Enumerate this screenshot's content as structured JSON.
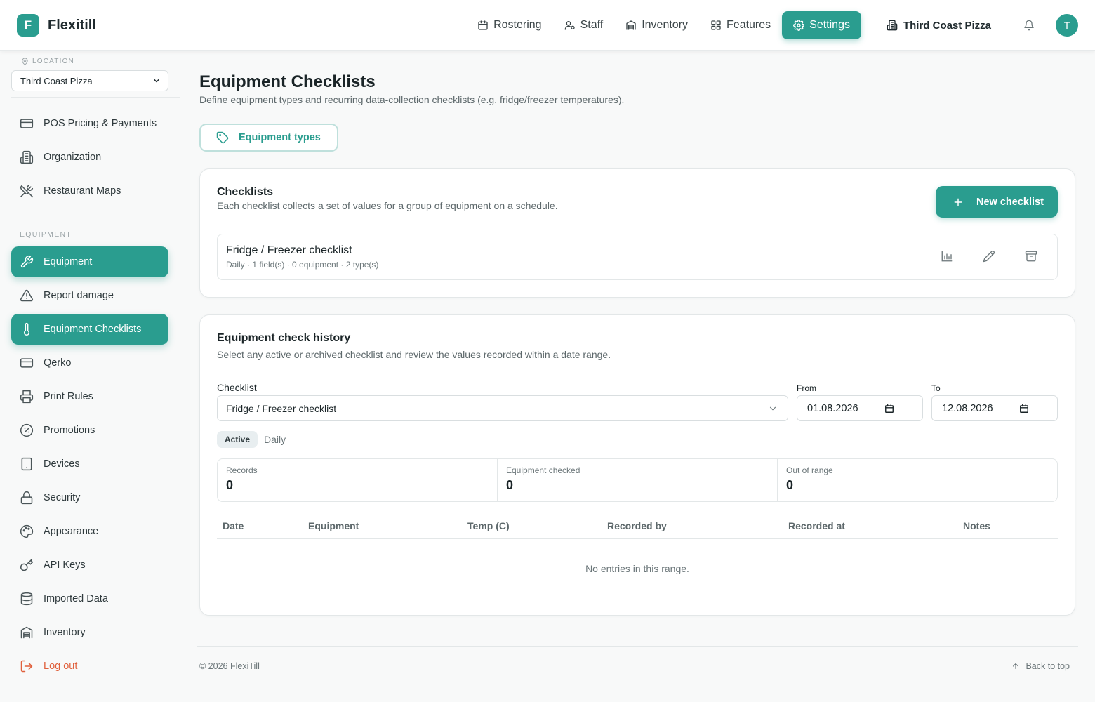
{
  "app": {
    "logo_letter": "F",
    "name": "Flexitill"
  },
  "topnav": {
    "items": [
      {
        "label": "Rostering",
        "icon": "calendar-icon"
      },
      {
        "label": "Staff",
        "icon": "staff-icon"
      },
      {
        "label": "Inventory",
        "icon": "warehouse-icon"
      },
      {
        "label": "Features",
        "icon": "grid-icon"
      },
      {
        "label": "Settings",
        "icon": "gear-icon",
        "active": true
      }
    ],
    "location": "Third Coast Pizza",
    "avatar_letter": "T"
  },
  "sidebar": {
    "location_label": "LOCATION",
    "location_value": "Third Coast Pizza",
    "items": [
      {
        "label": "POS Pricing & Payments",
        "icon": "card-icon"
      },
      {
        "label": "Organization",
        "icon": "building-icon"
      },
      {
        "label": "Restaurant Maps",
        "icon": "utensils-icon"
      }
    ],
    "section_label": "EQUIPMENT",
    "items2": [
      {
        "label": "Equipment",
        "icon": "wrench-icon",
        "active": true
      },
      {
        "label": "Report damage",
        "icon": "warning-icon"
      },
      {
        "label": "Equipment Checklists",
        "icon": "thermometer-icon",
        "active": true
      },
      {
        "label": "Qerko",
        "icon": "card-icon"
      },
      {
        "label": "Print Rules",
        "icon": "printer-icon"
      },
      {
        "label": "Promotions",
        "icon": "percent-icon"
      },
      {
        "label": "Devices",
        "icon": "tablet-icon"
      },
      {
        "label": "Security",
        "icon": "lock-icon"
      },
      {
        "label": "Appearance",
        "icon": "palette-icon"
      },
      {
        "label": "API Keys",
        "icon": "key-icon"
      },
      {
        "label": "Imported Data",
        "icon": "database-icon"
      },
      {
        "label": "Inventory",
        "icon": "warehouse-icon"
      },
      {
        "label": "Log out",
        "icon": "logout-icon"
      }
    ]
  },
  "page": {
    "title": "Equipment Checklists",
    "subtitle": "Define equipment types and recurring data-collection checklists (e.g. fridge/freezer temperatures).",
    "types_button": "Equipment types"
  },
  "checklists": {
    "title": "Checklists",
    "subtitle": "Each checklist collects a set of values for a group of equipment on a schedule.",
    "new_button": "New checklist",
    "rows": [
      {
        "name": "Fridge / Freezer checklist",
        "meta": "Daily · 1 field(s) · 0 equipment · 2 type(s)"
      }
    ]
  },
  "history": {
    "title": "Equipment check history",
    "subtitle": "Select any active or archived checklist and review the values recorded within a date range.",
    "checklist_label": "Checklist",
    "checklist_value": "Fridge / Freezer checklist",
    "from_label": "From",
    "from_value": "01.08.2026",
    "to_label": "To",
    "to_value": "12.08.2026",
    "status_badge": "Active",
    "frequency": "Daily",
    "stats": [
      {
        "label": "Records",
        "value": "0"
      },
      {
        "label": "Equipment checked",
        "value": "0"
      },
      {
        "label": "Out of range",
        "value": "0"
      }
    ],
    "columns": [
      "Date",
      "Equipment",
      "Temp (C)",
      "Recorded by",
      "Recorded at",
      "Notes"
    ],
    "empty_text": "No entries in this range."
  },
  "footer": {
    "copyright": "© 2026 FlexiTill",
    "back_to_top": "Back to top"
  },
  "colors": {
    "accent": "#2a9d8f",
    "danger": "#e0603c"
  }
}
